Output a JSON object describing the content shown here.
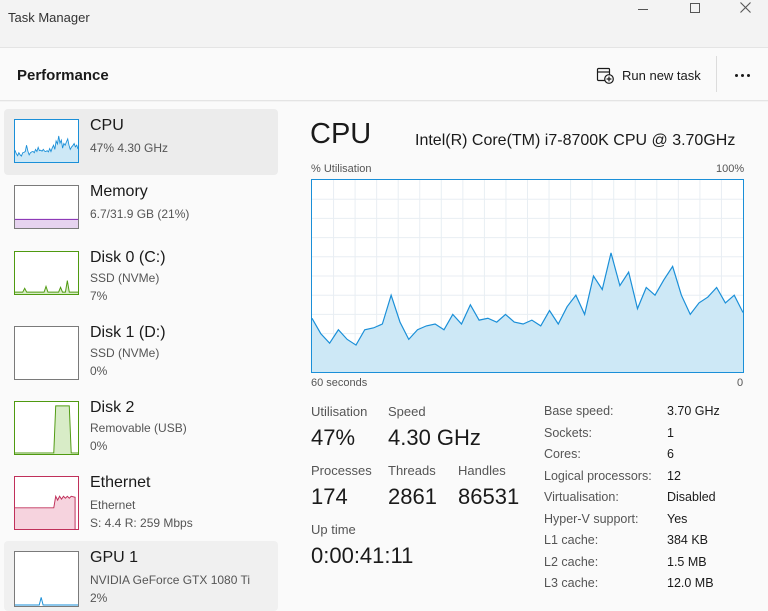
{
  "window": {
    "title": "Task Manager"
  },
  "header": {
    "title": "Performance",
    "run_new_task": "Run new task"
  },
  "sidebar": {
    "items": [
      {
        "name": "CPU",
        "line1": "47%  4.30 GHz",
        "line2": ""
      },
      {
        "name": "Memory",
        "line1": "6.7/31.9 GB (21%)",
        "line2": ""
      },
      {
        "name": "Disk 0 (C:)",
        "line1": "SSD (NVMe)",
        "line2": "7%"
      },
      {
        "name": "Disk 1 (D:)",
        "line1": "SSD (NVMe)",
        "line2": "0%"
      },
      {
        "name": "Disk 2",
        "line1": "Removable (USB)",
        "line2": "0%"
      },
      {
        "name": "Ethernet",
        "line1": "Ethernet",
        "line2": "S: 4.4  R: 259 Mbps"
      },
      {
        "name": "GPU 1",
        "line1": "NVIDIA GeForce GTX 1080 Ti",
        "line2": "2%"
      }
    ]
  },
  "main": {
    "heading": "CPU",
    "model": "Intel(R) Core(TM) i7-8700K CPU @ 3.70GHz",
    "graph": {
      "top_left": "% Utilisation",
      "top_right": "100%",
      "bottom_left": "60 seconds",
      "bottom_right": "0",
      "utilisation_series": [
        28,
        20,
        15,
        22,
        17,
        14,
        22,
        23,
        25,
        40,
        26,
        17,
        22,
        24,
        25,
        22,
        30,
        25,
        35,
        27,
        28,
        26,
        30,
        26,
        25,
        27,
        24,
        32,
        25,
        34,
        40,
        30,
        50,
        43,
        62,
        45,
        52,
        33,
        44,
        40,
        48,
        55,
        40,
        30,
        36,
        39,
        44,
        36,
        40,
        31
      ]
    },
    "stats": {
      "utilisation_label": "Utilisation",
      "utilisation": "47%",
      "speed_label": "Speed",
      "speed": "4.30 GHz",
      "processes_label": "Processes",
      "processes": "174",
      "threads_label": "Threads",
      "threads": "2861",
      "handles_label": "Handles",
      "handles": "86531",
      "uptime_label": "Up time",
      "uptime": "0:00:41:11"
    },
    "specs": [
      {
        "label": "Base speed:",
        "value": "3.70 GHz"
      },
      {
        "label": "Sockets:",
        "value": "1"
      },
      {
        "label": "Cores:",
        "value": "6"
      },
      {
        "label": "Logical processors:",
        "value": "12"
      },
      {
        "label": "Virtualisation:",
        "value": "Disabled"
      },
      {
        "label": "Hyper-V support:",
        "value": "Yes"
      },
      {
        "label": "L1 cache:",
        "value": "384 KB"
      },
      {
        "label": "L2 cache:",
        "value": "1.5 MB"
      },
      {
        "label": "L3 cache:",
        "value": "12.0 MB"
      }
    ]
  },
  "colors": {
    "cpu_line": "#1a8fd8",
    "cpu_fill": "#cde8f6",
    "memory_line": "#8e3ab8",
    "memory_fill": "#e6d3ef",
    "disk_line": "#4f9a10",
    "disk_fill": "#d8ecc7",
    "ethernet_line": "#c0305a",
    "ethernet_fill": "#f6d3de"
  }
}
